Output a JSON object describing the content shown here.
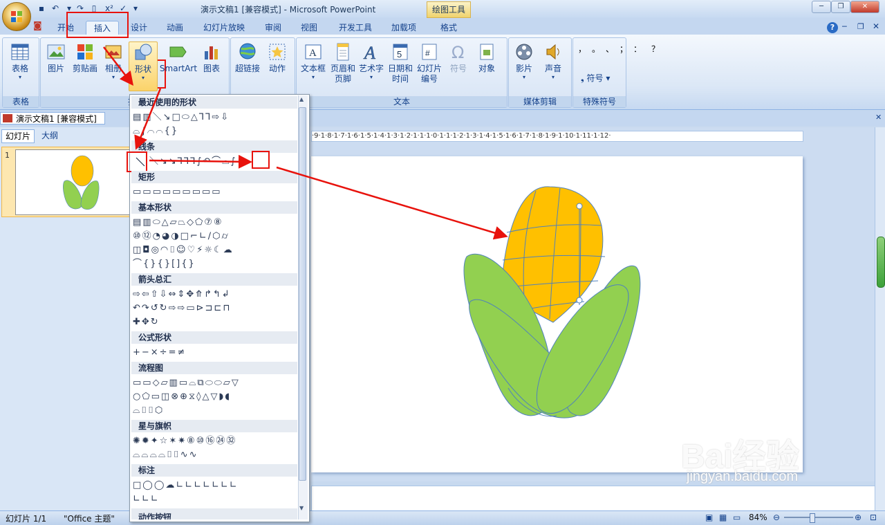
{
  "window": {
    "title": "演示文稿1 [兼容模式] - Microsoft PowerPoint",
    "context_tab": "绘图工具"
  },
  "tabs": [
    "开始",
    "插入",
    "设计",
    "动画",
    "幻灯片放映",
    "审阅",
    "视图",
    "开发工具",
    "加载项",
    "格式"
  ],
  "ribbon": {
    "groups": {
      "table": "表格",
      "illustrations": "插",
      "text": "文本",
      "media": "媒体剪辑",
      "symbols": "特殊符号"
    },
    "buttons": {
      "table": "表格",
      "picture": "图片",
      "clipart": "剪贴画",
      "album": "相册",
      "shapes": "形状",
      "smartart": "SmartArt",
      "chart": "图表",
      "hyperlink": "超链接",
      "action": "动作",
      "textbox": "文本框",
      "header_footer_1": "页眉和",
      "header_footer_2": "页脚",
      "wordart": "艺术字",
      "datetime_1": "日期和",
      "datetime_2": "时间",
      "slidenum_1": "幻灯片",
      "slidenum_2": "编号",
      "symbol": "符号",
      "object": "对象",
      "movie": "影片",
      "sound": "声音",
      "special_symbol": "符号"
    }
  },
  "document_tab": "演示文稿1 [兼容模式]",
  "panel": {
    "tab_slides": "幻灯片",
    "tab_outline": "大纲",
    "slide_number": "1"
  },
  "ruler_text": "·9·1·8·1·7·1·6·1·5·1·4·1·3·1·2·1·1·1·0·1·1·1·2·1·3·1·4·1·5·1·6·1·7·1·8·1·9·1·10·1·11·1·12·",
  "shapes_gallery": {
    "sections": {
      "recent": "最近使用的形状",
      "lines": "线条",
      "rectangles": "矩形",
      "basic": "基本形状",
      "arrows": "箭头总汇",
      "equation": "公式形状",
      "flowchart": "流程图",
      "stars": "星与旗帜",
      "callouts": "标注",
      "action_buttons": "动作按钮"
    },
    "rows": {
      "recent_1": "▤▥＼↘□⬭△⅂⅂⇨⇩",
      "recent_2": "⌓∫⌒⌒{}",
      "lines": "＼↘↘⅂⅂⅂∫↶⌒⌓∫",
      "rectangles": "▭▭▭▭▭▭▭▭▭",
      "basic_1": "▤▥⬭△▱⏢◇⬠⑦⑧",
      "basic_2": "⑩⑫◔◕◑□⌐∟∕⬡⌭",
      "basic_3": "◫◘◎◠⌷☺♡⚡☼☾☁",
      "basic_4": "⌒{}{}[]{}",
      "arrows_1": "⇨⇦⇧⇩⇔⇕✥⤊↱↰↲",
      "arrows_2": "↶↷↺↻⇨⇨▭⊳⊐⊏⊓",
      "arrows_3": "✚✥↻",
      "equation": "+−×÷=≠",
      "flow_1": "▭▭◇▱▥▭⌓⧉⬭⬭▱▽",
      "flow_2": "○⬠▭◫⊗⊕⧖◊△▽◗◖",
      "flow_3": "⌓⌷⌷⬡",
      "stars_1": "✺✹✦☆✶✷⑧⑩⑯㉔㉜",
      "stars_2": "⌓⌓⌓⌓⌷⌷∿∿",
      "callouts_1": "□◯◯☁∟∟∟∟∟∟∟",
      "callouts_2": "∟∟∟"
    }
  },
  "status": {
    "slide_info": "幻灯片 1/1",
    "theme": "\"Office 主题\"",
    "zoom": "84%"
  },
  "watermark": {
    "main": "Bai经验",
    "sub": "jingyan.baidu.com"
  },
  "colors": {
    "accent_red": "#e8120c",
    "corn_yellow": "#ffc000",
    "leaf_green": "#92d050",
    "outline_blue": "#4f81bd"
  }
}
